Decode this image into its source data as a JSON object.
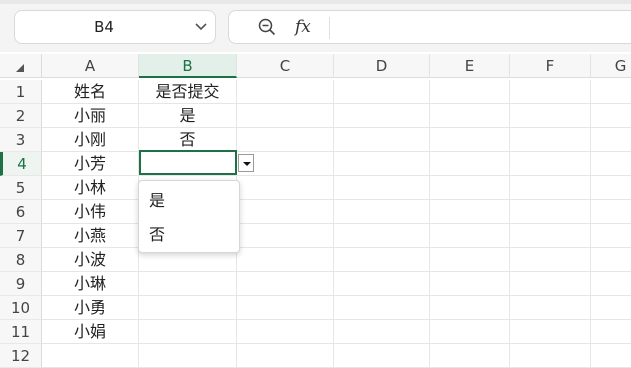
{
  "name_box": {
    "value": "B4"
  },
  "formula_bar": {
    "fx_label": "fx",
    "value": ""
  },
  "columns": [
    "A",
    "B",
    "C",
    "D",
    "E",
    "F",
    "G"
  ],
  "selected_column": "B",
  "rows": [
    "1",
    "2",
    "3",
    "4",
    "5",
    "6",
    "7",
    "8",
    "9",
    "10",
    "11",
    "12"
  ],
  "selected_row": "4",
  "cells": {
    "A": [
      "姓名",
      "小丽",
      "小刚",
      "小芳",
      "小林",
      "小伟",
      "小燕",
      "小波",
      "小琳",
      "小勇",
      "小娟",
      ""
    ],
    "B": [
      "是否提交",
      "是",
      "否",
      "",
      "",
      "",
      "",
      "",
      "",
      "",
      "",
      ""
    ]
  },
  "dropdown": {
    "options": [
      "是",
      "否"
    ]
  },
  "colors": {
    "accent": "#1e7145"
  }
}
